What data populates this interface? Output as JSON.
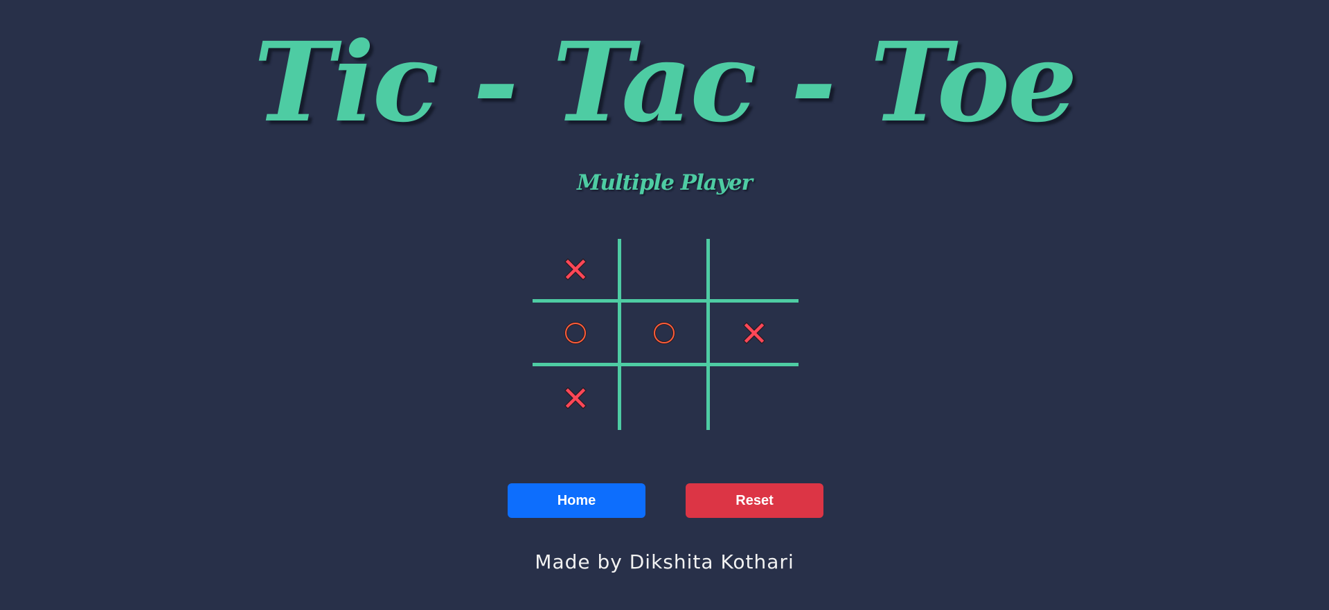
{
  "title": "Tic - Tac - Toe",
  "subtitle": "Multiple Player",
  "board": [
    [
      "X",
      "",
      ""
    ],
    [
      "O",
      "O",
      "X"
    ],
    [
      "X",
      "",
      ""
    ]
  ],
  "buttons": {
    "home_label": "Home",
    "reset_label": "Reset"
  },
  "credit": "Made by Dikshita Kothari",
  "colors": {
    "background": "#283049",
    "accent": "#4ecca3",
    "x_mark": "#ff4757",
    "o_mark": "#ff5e3a",
    "home_button": "#0d6efd",
    "reset_button": "#dc3545"
  }
}
